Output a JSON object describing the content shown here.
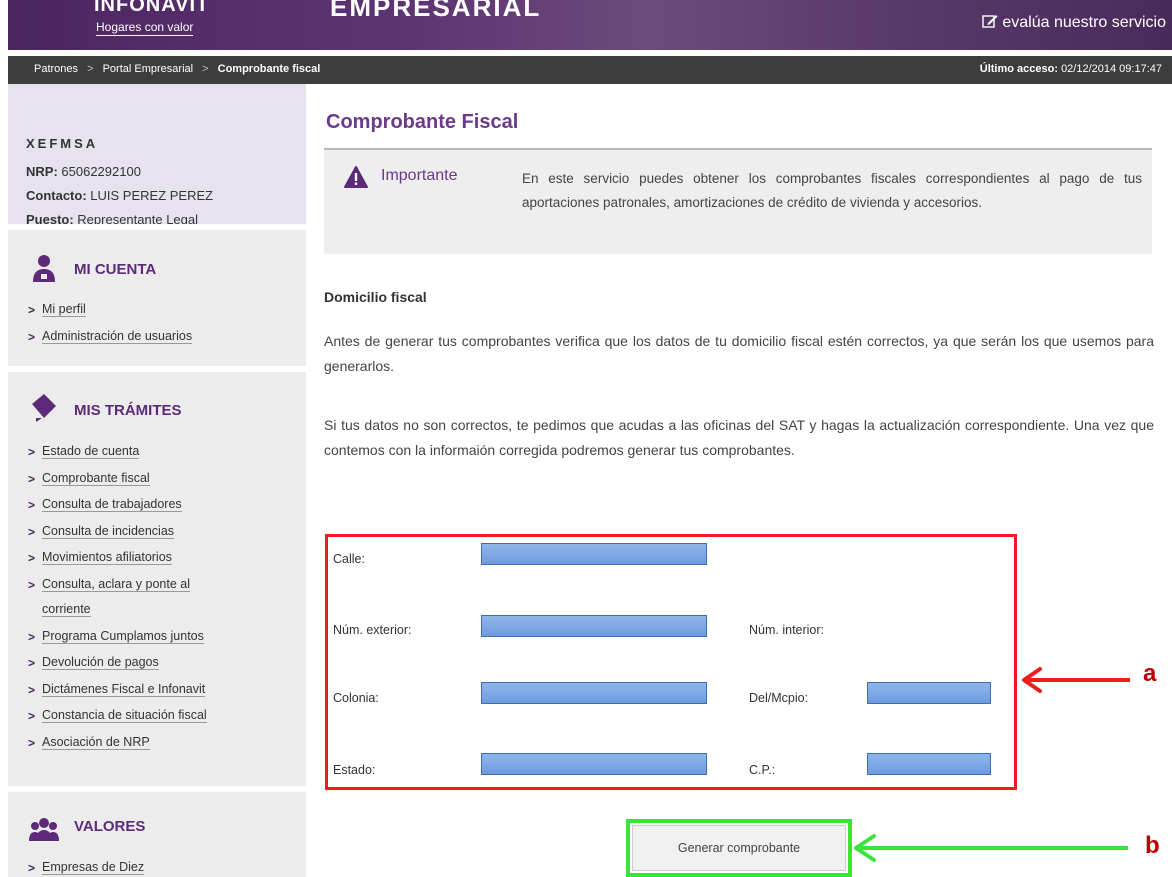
{
  "header": {
    "brand": "INFONAVIT",
    "brand_sub": "Hogares con valor",
    "portal": "EMPRESARIAL",
    "evaluate_link": "evalúa nuestro servicio"
  },
  "breadcrumb": {
    "items": [
      "Patrones",
      "Portal Empresarial",
      "Comprobante fiscal"
    ],
    "separator": ">",
    "last_access_label": "Último acceso:",
    "last_access_value": "02/12/2014 09:17:47"
  },
  "user": {
    "company": "XEFMSA",
    "nrp_label": "NRP:",
    "nrp_value": "65062292100",
    "contact_label": "Contacto:",
    "contact_value": "LUIS PEREZ PEREZ",
    "position_label": "Puesto:",
    "position_value": "Representante Legal"
  },
  "sidebar": {
    "mi_cuenta": {
      "title": "MI CUENTA",
      "items": [
        "Mi perfil",
        "Administración de usuarios"
      ]
    },
    "mis_tramites": {
      "title": "MIS TRÁMITES",
      "items": [
        "Estado de cuenta",
        "Comprobante fiscal",
        "Consulta de trabajadores",
        "Consulta de incidencias",
        "Movimientos afiliatorios",
        "Consulta, aclara y ponte al",
        "corriente",
        "Programa Cumplamos juntos",
        "Devolución de pagos",
        "Dictámenes Fiscal e Infonavit",
        "Constancia de situación fiscal",
        "Asociación de NRP"
      ]
    },
    "valores": {
      "title": "VALORES",
      "items": [
        "Empresas de Diez"
      ]
    }
  },
  "main": {
    "title": "Comprobante Fiscal",
    "important_label": "Importante",
    "important_text": "En este servicio puedes obtener los comprobantes fiscales correspondientes al pago de tus aportaciones patronales, amortizaciones de crédito de vivienda y accesorios.",
    "section_heading": "Domicilio fiscal",
    "paragraph1": "Antes de generar tus comprobantes verifica que los datos de tu domicilio fiscal estén correctos, ya que serán los que usemos para generarlos.",
    "paragraph2": "Si tus datos no son correctos, te pedimos que acudas a las oficinas del SAT y hagas la actualización correspondiente. Una vez que contemos con la informaión corregida podremos generar tus comprobantes.",
    "fields": {
      "calle": "Calle:",
      "num_exterior": "Núm. exterior:",
      "num_interior": "Núm. interior:",
      "colonia": "Colonia:",
      "del_mcpio": "Del/Mcpio:",
      "estado": "Estado:",
      "cp": "C.P.:"
    },
    "generate_button": "Generar comprobante"
  },
  "annotations": {
    "label_a": "a",
    "label_b": "b",
    "red": "#ee1c1c",
    "green": "#39e33a"
  },
  "colors": {
    "purple": "#6b3a8a",
    "header": "#4b2560",
    "crumbbar": "#3d3d3d"
  }
}
